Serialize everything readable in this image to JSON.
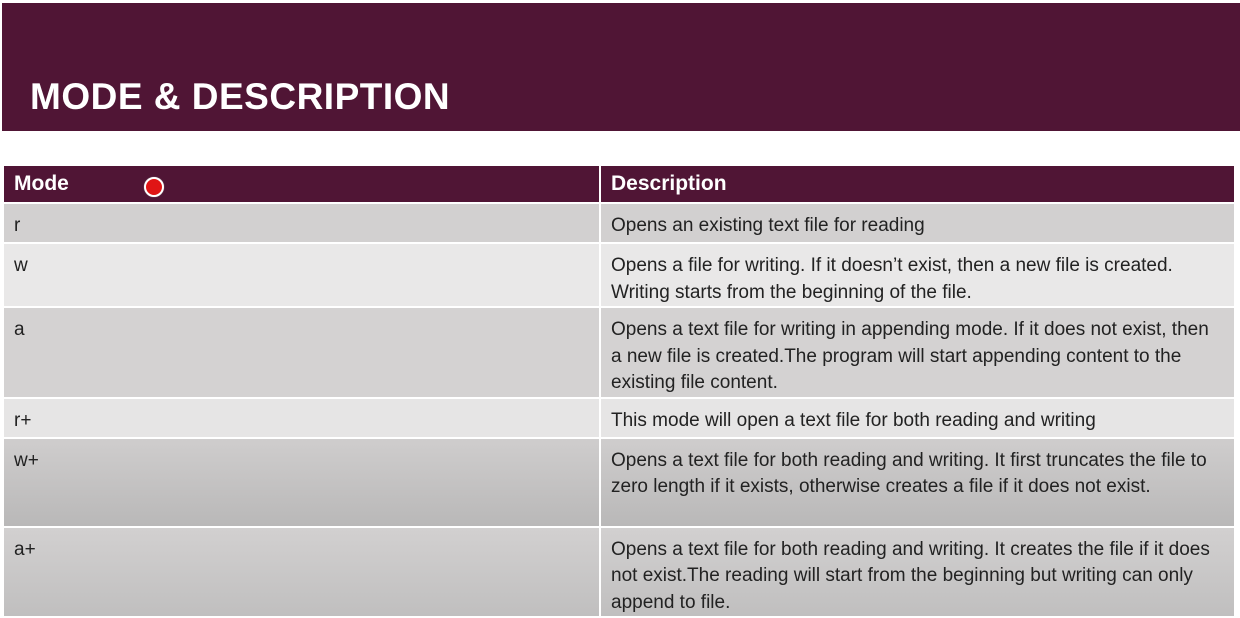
{
  "slide": {
    "title": "MODE & DESCRIPTION",
    "accent_color": "#501535"
  },
  "table": {
    "headers": [
      "Mode",
      "Description"
    ],
    "rows": [
      {
        "mode": "r",
        "description": "Opens an existing text file for reading"
      },
      {
        "mode": "w",
        "description": "Opens a file for writing. If it doesn’t exist, then a new file is created. Writing starts from the beginning of the file."
      },
      {
        "mode": "a",
        "description": "Opens a text file for writing in appending mode. If it does not exist, then a new file is created.The program will start appending content to the existing file content."
      },
      {
        "mode": "r+",
        "description": "This mode will open a text file for both reading and writing"
      },
      {
        "mode": "w+",
        "description": "Opens a text file for both reading and writing. It first truncates the file to zero length if it exists, otherwise creates a file if it does not exist."
      },
      {
        "mode": "a+",
        "description": "Opens a text file for both reading and writing. It creates the file if it does not exist.The reading will start from the beginning but writing can only append to file."
      }
    ]
  },
  "cursor": {
    "icon": "red-dot-cursor-icon"
  }
}
